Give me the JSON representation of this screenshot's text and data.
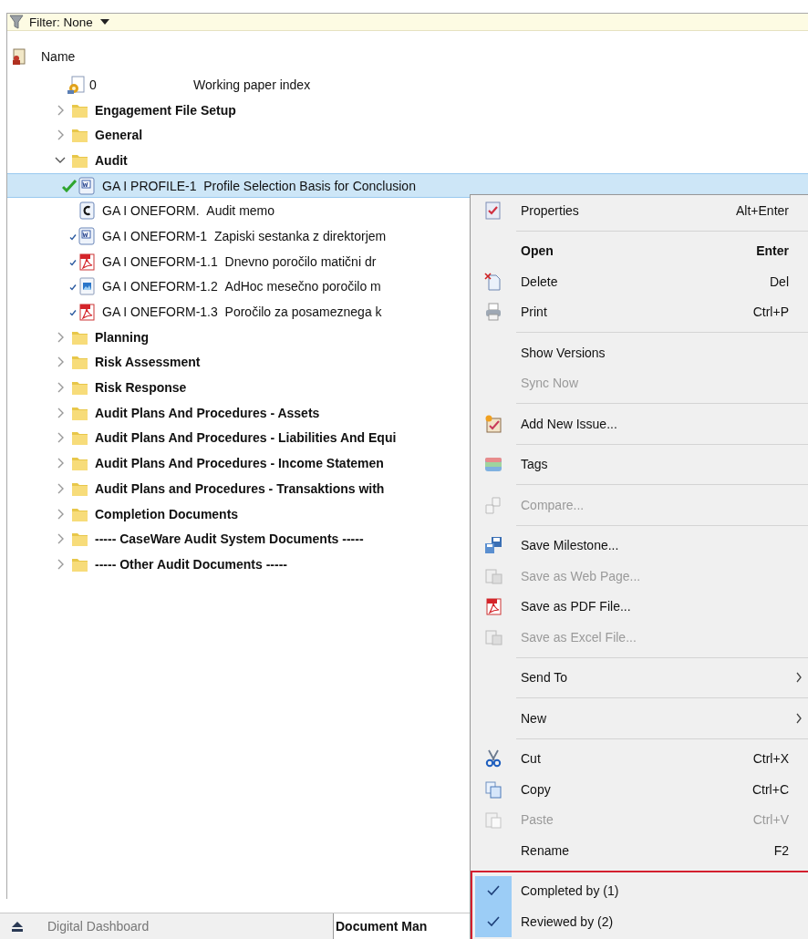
{
  "filter": {
    "label": "Filter: None"
  },
  "tree": {
    "header": "Name",
    "items": [
      {
        "kind": "index",
        "number": "0",
        "title": "Working paper index",
        "selected": false
      },
      {
        "kind": "folder",
        "label": "Engagement File Setup",
        "expanded": false,
        "selected": false
      },
      {
        "kind": "folder",
        "label": "General",
        "expanded": false,
        "selected": false
      },
      {
        "kind": "folder",
        "label": "Audit",
        "expanded": true,
        "selected": false,
        "children": [
          {
            "kind": "word",
            "label": "GA I PROFILE-1  Profile Selection Basis for Conclusion",
            "completed": true,
            "reviewed": true,
            "selected": true
          },
          {
            "kind": "cdoc",
            "label": "GA I ONEFORM.  Audit memo",
            "completed": false,
            "reviewed": false,
            "selected": false
          },
          {
            "kind": "word",
            "label": "GA I ONEFORM-1  Zapiski sestanka z direktorjem",
            "completed": true,
            "reviewed": false,
            "selected": false
          },
          {
            "kind": "pdf",
            "label": "GA I ONEFORM-1.1  Dnevno poročilo matični dr",
            "completed": true,
            "reviewed": false,
            "selected": false
          },
          {
            "kind": "image",
            "label": "GA I ONEFORM-1.2  AdHoc mesečno poročilo m",
            "completed": true,
            "reviewed": false,
            "selected": false
          },
          {
            "kind": "pdf",
            "label": "GA I ONEFORM-1.3  Poročilo za posameznega k",
            "completed": true,
            "reviewed": false,
            "selected": false
          }
        ]
      },
      {
        "kind": "folder",
        "label": "Planning",
        "expanded": false,
        "selected": false
      },
      {
        "kind": "folder",
        "label": "Risk Assessment",
        "expanded": false,
        "selected": false
      },
      {
        "kind": "folder",
        "label": "Risk Response",
        "expanded": false,
        "selected": false
      },
      {
        "kind": "folder",
        "label": "Audit Plans And Procedures - Assets",
        "expanded": false,
        "selected": false
      },
      {
        "kind": "folder",
        "label": "Audit Plans And Procedures - Liabilities And Equi",
        "expanded": false,
        "selected": false
      },
      {
        "kind": "folder",
        "label": "Audit Plans And Procedures - Income Statemen",
        "expanded": false,
        "selected": false
      },
      {
        "kind": "folder",
        "label": "Audit Plans and Procedures - Transaktions with",
        "expanded": false,
        "selected": false
      },
      {
        "kind": "folder",
        "label": "Completion Documents",
        "expanded": false,
        "selected": false
      },
      {
        "kind": "folder",
        "label": "----- CaseWare Audit System Documents -----",
        "expanded": false,
        "selected": false
      },
      {
        "kind": "folder",
        "label": "----- Other Audit Documents -----",
        "expanded": false,
        "selected": false
      }
    ]
  },
  "context_menu": {
    "items": [
      {
        "kind": "item",
        "label": "Properties",
        "shortcut": "Alt+Enter",
        "disabled": false,
        "default": false
      },
      {
        "kind": "separator"
      },
      {
        "kind": "item",
        "label": "Open",
        "shortcut": "Enter",
        "disabled": false,
        "default": true
      },
      {
        "kind": "item",
        "label": "Delete",
        "shortcut": "Del",
        "disabled": false,
        "default": false
      },
      {
        "kind": "item",
        "label": "Print",
        "shortcut": "Ctrl+P",
        "disabled": false,
        "default": false
      },
      {
        "kind": "separator"
      },
      {
        "kind": "item",
        "label": "Show Versions",
        "disabled": false,
        "default": false
      },
      {
        "kind": "item",
        "label": "Sync Now",
        "disabled": true,
        "default": false
      },
      {
        "kind": "separator"
      },
      {
        "kind": "item",
        "label": "Add New Issue...",
        "disabled": false,
        "default": false
      },
      {
        "kind": "separator"
      },
      {
        "kind": "item",
        "label": "Tags",
        "disabled": false,
        "default": false
      },
      {
        "kind": "separator"
      },
      {
        "kind": "item",
        "label": "Compare...",
        "disabled": true,
        "default": false
      },
      {
        "kind": "separator"
      },
      {
        "kind": "item",
        "label": "Save Milestone...",
        "disabled": false,
        "default": false
      },
      {
        "kind": "item",
        "label": "Save as Web Page...",
        "disabled": true,
        "default": false
      },
      {
        "kind": "item",
        "label": "Save as PDF File...",
        "disabled": false,
        "default": false
      },
      {
        "kind": "item",
        "label": "Save as Excel File...",
        "disabled": true,
        "default": false
      },
      {
        "kind": "separator"
      },
      {
        "kind": "submenu",
        "label": "Send To",
        "disabled": false,
        "default": false
      },
      {
        "kind": "separator"
      },
      {
        "kind": "submenu",
        "label": "New",
        "disabled": false,
        "default": false
      },
      {
        "kind": "separator"
      },
      {
        "kind": "item",
        "label": "Cut",
        "shortcut": "Ctrl+X",
        "disabled": false,
        "default": false
      },
      {
        "kind": "item",
        "label": "Copy",
        "shortcut": "Ctrl+C",
        "disabled": false,
        "default": false
      },
      {
        "kind": "item",
        "label": "Paste",
        "shortcut": "Ctrl+V",
        "disabled": true,
        "default": false
      },
      {
        "kind": "item",
        "label": "Rename",
        "shortcut": "F2",
        "disabled": false,
        "default": false
      },
      {
        "kind": "separator"
      },
      {
        "kind": "check",
        "label": "Completed by (1)",
        "checked": true,
        "disabled": false,
        "default": false
      },
      {
        "kind": "check",
        "label": "Reviewed by (2)",
        "checked": true,
        "disabled": false,
        "default": false
      }
    ]
  },
  "bottom_tabs": [
    {
      "label": "Digital Dashboard",
      "selected": false
    },
    {
      "label": "Document Man",
      "selected": true
    }
  ]
}
